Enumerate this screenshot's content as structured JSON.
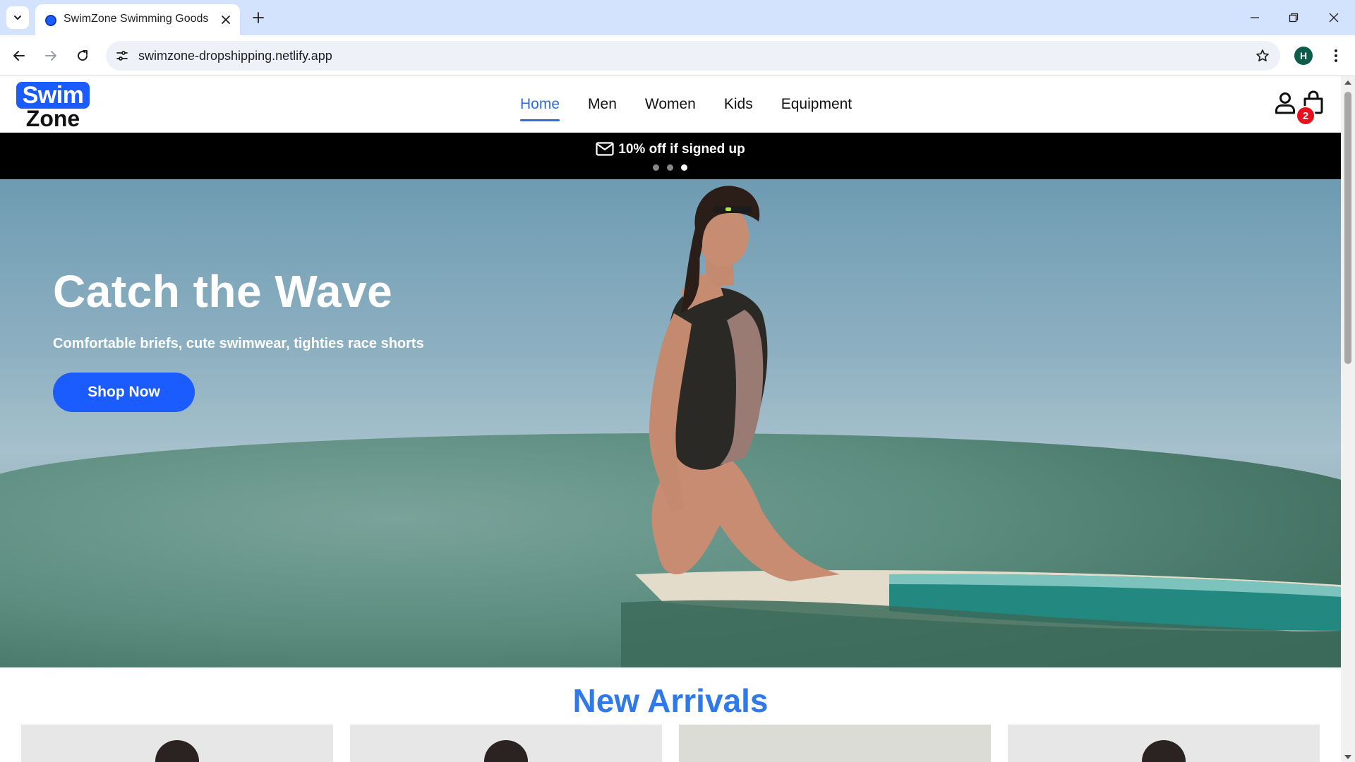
{
  "browser": {
    "tab_title": "SwimZone Swimming Goods",
    "url": "swimzone-dropshipping.netlify.app",
    "profile_initial": "H"
  },
  "site": {
    "logo_top": "Swim",
    "logo_bottom": "Zone",
    "nav": [
      {
        "label": "Home",
        "active": true
      },
      {
        "label": "Men",
        "active": false
      },
      {
        "label": "Women",
        "active": false
      },
      {
        "label": "Kids",
        "active": false
      },
      {
        "label": "Equipment",
        "active": false
      }
    ],
    "cart_count": "2",
    "brand_color": "#1a5cff",
    "accent_color": "#2f7ae8",
    "badge_color": "#e8101d"
  },
  "promo": {
    "text": "10% off if signed up",
    "icon": "mail-icon",
    "slides": 3,
    "active_slide": 3
  },
  "hero": {
    "title": "Catch the Wave",
    "subtitle": "Comfortable briefs, cute swimwear, tighties race shorts",
    "cta": "Shop Now"
  },
  "arrivals": {
    "title": "New Arrivals"
  }
}
